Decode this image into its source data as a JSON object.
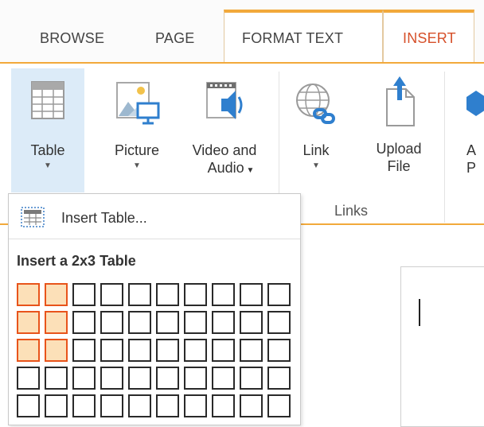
{
  "tabs": [
    {
      "label": "BROWSE"
    },
    {
      "label": "PAGE"
    },
    {
      "label": "FORMAT TEXT"
    },
    {
      "label": "INSERT"
    }
  ],
  "ribbon": {
    "table": {
      "label": "Table"
    },
    "picture": {
      "label": "Picture"
    },
    "video": {
      "label1": "Video and",
      "label2": "Audio"
    },
    "link": {
      "label": "Link"
    },
    "upload": {
      "label1": "Upload",
      "label2": "File"
    },
    "partial": {
      "label1": "A",
      "label2": "P"
    },
    "groups": {
      "links": "Links"
    }
  },
  "dropdown": {
    "insert_table_label": "Insert Table...",
    "grid_title": "Insert a 2x3 Table",
    "grid": {
      "columns": 10,
      "visible_rows": 5,
      "selected_cols": 2,
      "selected_rows": 3
    }
  },
  "colors": {
    "accent": "#f2a93b",
    "active_tab_text": "#d6502a",
    "selection": "#e8541b"
  }
}
